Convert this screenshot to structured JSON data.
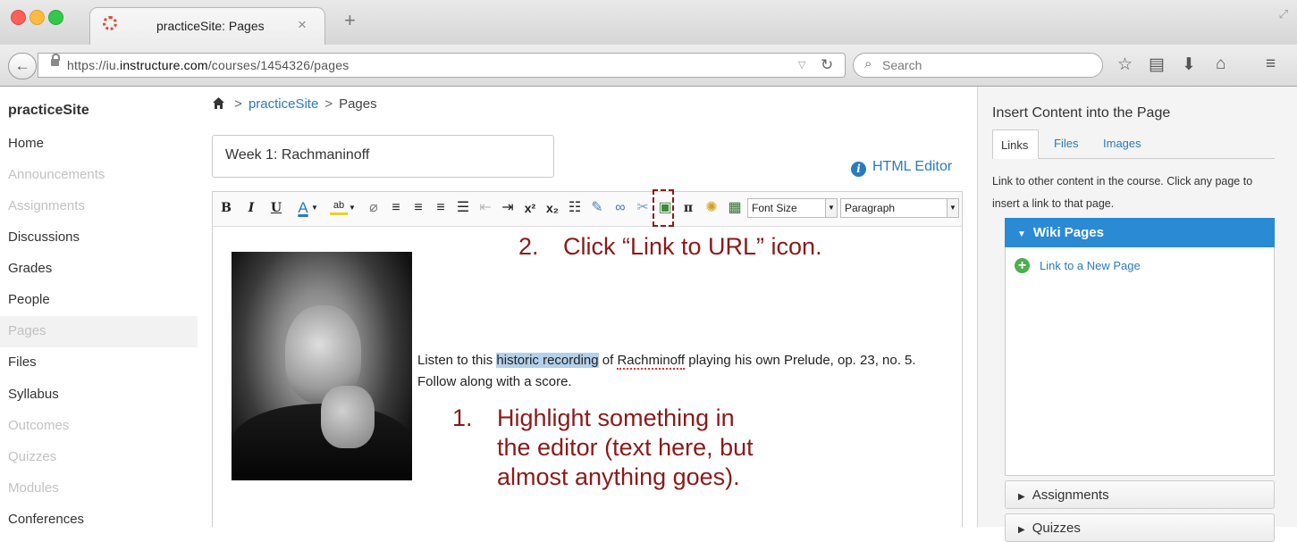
{
  "browser": {
    "tab_title": "practiceSite: Pages",
    "tab_close": "×",
    "new_tab": "+",
    "url_prefix": "https://iu.",
    "url_domain": "instructure.com",
    "url_path": "/courses/1454326/pages",
    "search_placeholder": "Search"
  },
  "course_nav": {
    "course_name": "practiceSite",
    "items": [
      {
        "label": "Home",
        "state": "normal"
      },
      {
        "label": "Announcements",
        "state": "disabled"
      },
      {
        "label": "Assignments",
        "state": "disabled"
      },
      {
        "label": "Discussions",
        "state": "normal"
      },
      {
        "label": "Grades",
        "state": "normal"
      },
      {
        "label": "People",
        "state": "normal"
      },
      {
        "label": "Pages",
        "state": "active"
      },
      {
        "label": "Files",
        "state": "normal"
      },
      {
        "label": "Syllabus",
        "state": "normal"
      },
      {
        "label": "Outcomes",
        "state": "disabled"
      },
      {
        "label": "Quizzes",
        "state": "disabled"
      },
      {
        "label": "Modules",
        "state": "disabled"
      },
      {
        "label": "Conferences",
        "state": "normal"
      }
    ]
  },
  "breadcrumb": {
    "sep": ">",
    "course": "practiceSite",
    "current": "Pages"
  },
  "page": {
    "title_value": "Week 1: Rachmaninoff",
    "html_editor_label": "HTML Editor",
    "info_glyph": "i"
  },
  "toolbar": {
    "bold": "B",
    "italic": "I",
    "underline": "U",
    "font_color": "A",
    "superscript": "x²",
    "subscript": "x₂",
    "math": "π",
    "font_size": "Font Size",
    "format": "Paragraph"
  },
  "content": {
    "text_before": "Listen to this ",
    "highlighted": "historic recording",
    "text_mid": " of ",
    "misspelled": "Rachminoff",
    "text_after": " playing his own Prelude, op. 23, no. 5. Follow along with a score."
  },
  "annotations": {
    "step2_number": "2.",
    "step2_text": "Click “Link to URL” icon.",
    "step1_number": "1.",
    "step1_line1": "Highlight something in",
    "step1_line2": "the editor (text here, but",
    "step1_line3": "almost anything goes)."
  },
  "sidebar": {
    "title": "Insert Content into the Page",
    "tabs": [
      "Links",
      "Files",
      "Images"
    ],
    "description": "Link to other content in the course. Click any page to insert a link to that page.",
    "wiki_header": "Wiki Pages",
    "new_page_link": "Link to a New Page",
    "accordion": [
      "Assignments",
      "Quizzes"
    ]
  },
  "colors": {
    "link_blue": "#2a7bbd",
    "annotation_red": "#8b1a1a",
    "highlight": "#b4d0ea",
    "wiki_header_bg": "#2a8ad4"
  }
}
